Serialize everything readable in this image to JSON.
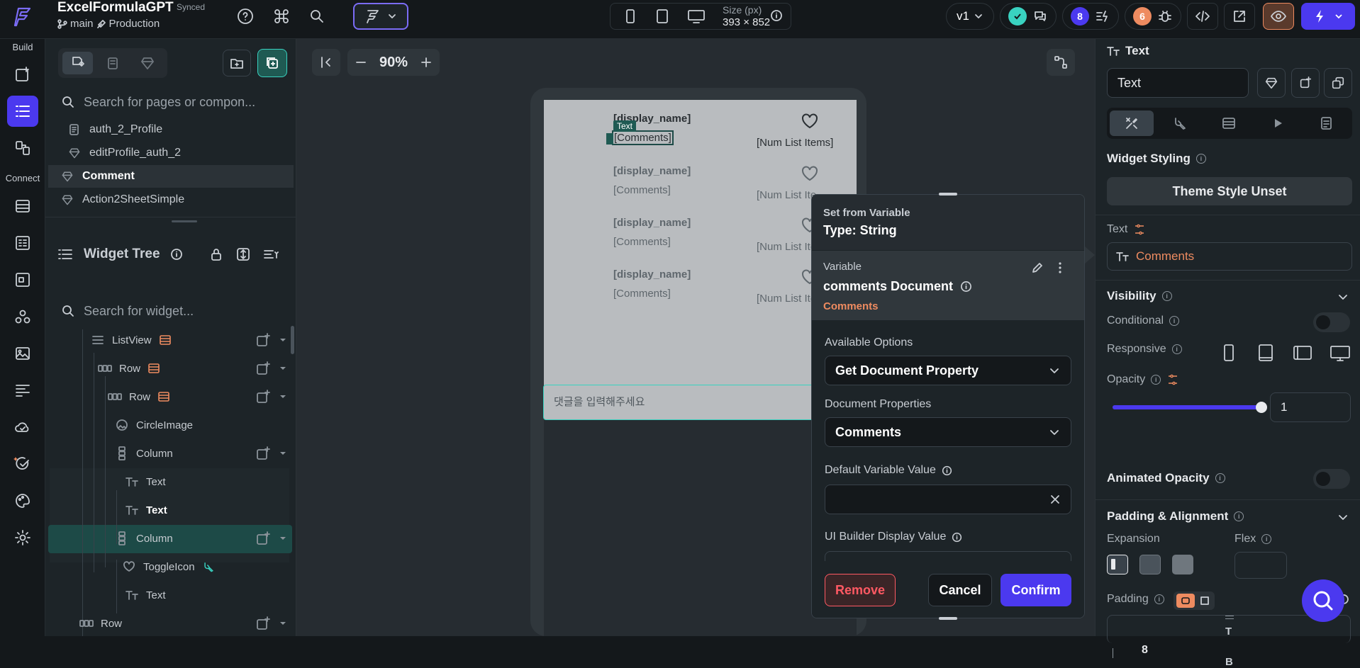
{
  "topbar": {
    "project_name": "ExcelFormulaGPT",
    "sync_status": "Synced",
    "branch": "main",
    "environment": "Production",
    "size_label": "Size (px)",
    "size_value": "393 × 852",
    "version": "v1",
    "agent_count": "8",
    "issue_count": "6"
  },
  "rail": {
    "build_label": "Build",
    "connect_label": "Connect"
  },
  "nav": {
    "search_pages_placeholder": "Search for pages or compon...",
    "pages": [
      {
        "label": "auth_2_Profile",
        "icon": "page-icon"
      },
      {
        "label": "editProfile_auth_2",
        "icon": "component-icon"
      },
      {
        "label": "Comment",
        "icon": "component-icon",
        "selected": true
      },
      {
        "label": "Action2SheetSimple",
        "icon": "component-icon"
      }
    ],
    "widget_tree_title": "Widget Tree",
    "search_widgets_placeholder": "Search for widget...",
    "tree": [
      {
        "label": "ListView",
        "icon": "list-icon"
      },
      {
        "label": "Row",
        "icon": "row-icon"
      },
      {
        "label": "Row",
        "icon": "row-icon"
      },
      {
        "label": "CircleImage",
        "icon": "circle-image-icon"
      },
      {
        "label": "Column",
        "icon": "column-icon"
      },
      {
        "label": "Text",
        "icon": "text-icon"
      },
      {
        "label": "Text",
        "icon": "text-icon",
        "selected": true
      },
      {
        "label": "Column",
        "icon": "column-icon"
      },
      {
        "label": "ToggleIcon",
        "icon": "heart-icon"
      },
      {
        "label": "Text",
        "icon": "text-icon"
      },
      {
        "label": "Row",
        "icon": "row-icon"
      }
    ]
  },
  "canvas": {
    "zoom": "90%",
    "selected_tag": "Text",
    "items": [
      {
        "name": "[display_name]",
        "comment": "[Comments]",
        "num": "[Num List Items]"
      },
      {
        "name": "[display_name]",
        "comment": "[Comments]",
        "num": "[Num List Ite"
      },
      {
        "name": "[display_name]",
        "comment": "[Comments]",
        "num": "[Num List Ite"
      },
      {
        "name": "[display_name]",
        "comment": "[Comments]",
        "num": "[Num List Ite"
      }
    ],
    "comment_placeholder": "댓글을 입력해주세요"
  },
  "popup": {
    "header_small": "Set from Variable",
    "header_type": "Type: String",
    "variable_label": "Variable",
    "variable_name": "comments Document",
    "variable_field": "Comments",
    "available_options_label": "Available Options",
    "available_options_value": "Get Document Property",
    "document_properties_label": "Document Properties",
    "document_properties_value": "Comments",
    "default_value_label": "Default Variable Value",
    "default_value": "",
    "ui_builder_label": "UI Builder Display Value",
    "remove_label": "Remove",
    "cancel_label": "Cancel",
    "confirm_label": "Confirm"
  },
  "props": {
    "widget_type": "Text",
    "widget_name": "Text",
    "widget_styling_label": "Widget Styling",
    "theme_style_label": "Theme Style Unset",
    "text_label": "Text",
    "text_value": "Comments",
    "visibility_label": "Visibility",
    "conditional_label": "Conditional",
    "responsive_label": "Responsive",
    "opacity_label": "Opacity",
    "opacity_value": "1",
    "opacity_level": 1,
    "animated_opacity_label": "Animated Opacity",
    "padding_alignment_label": "Padding & Alignment",
    "expansion_label": "Expansion",
    "flex_label": "Flex",
    "padding_label": "Padding",
    "padding_left": "8",
    "padding_top_label": "T",
    "padding_bottom_label": "B"
  },
  "colors": {
    "accent": "#4b39ef",
    "selection": "#1d4a47",
    "teal": "#39d2c0",
    "warning": "#ee8b60",
    "error": "#ff5963"
  }
}
